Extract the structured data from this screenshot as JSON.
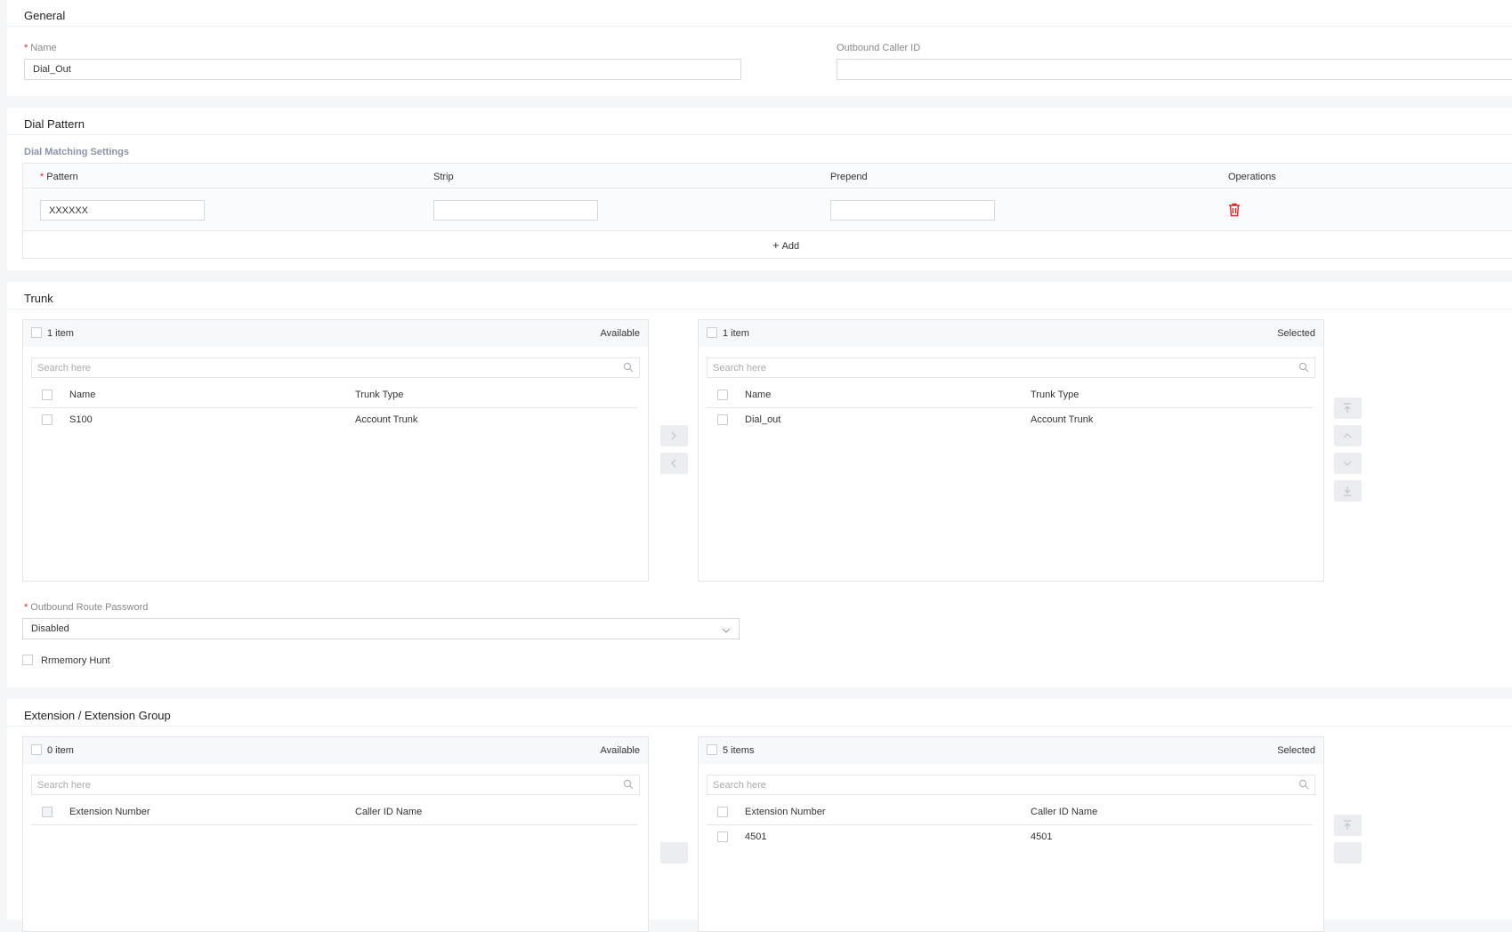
{
  "general": {
    "title": "General",
    "name_label": "Name",
    "name_value": "Dial_Out",
    "caller_id_label": "Outbound Caller ID",
    "caller_id_value": ""
  },
  "dial_pattern": {
    "title": "Dial Pattern",
    "subtitle": "Dial Matching Settings",
    "columns": {
      "pattern": "Pattern",
      "strip": "Strip",
      "prepend": "Prepend",
      "operations": "Operations"
    },
    "row": {
      "pattern": "XXXXXX",
      "strip": "",
      "prepend": ""
    },
    "add_label": "Add"
  },
  "trunk": {
    "title": "Trunk",
    "available": {
      "count": "1 item",
      "status": "Available",
      "search_placeholder": "Search here",
      "col_name": "Name",
      "col_type": "Trunk Type",
      "rows": [
        {
          "name": "S100",
          "type": "Account Trunk"
        }
      ]
    },
    "selected": {
      "count": "1 item",
      "status": "Selected",
      "search_placeholder": "Search here",
      "col_name": "Name",
      "col_type": "Trunk Type",
      "rows": [
        {
          "name": "Dial_out",
          "type": "Account Trunk"
        }
      ]
    },
    "password_label": "Outbound Route Password",
    "password_value": "Disabled",
    "memory_hunt_label": "Rrmemory Hunt"
  },
  "extension": {
    "title": "Extension / Extension Group",
    "available": {
      "count": "0 item",
      "status": "Available",
      "search_placeholder": "Search here",
      "col_number": "Extension Number",
      "col_caller": "Caller ID Name"
    },
    "selected": {
      "count": "5 items",
      "status": "Selected",
      "search_placeholder": "Search here",
      "col_number": "Extension Number",
      "col_caller": "Caller ID Name",
      "rows": [
        {
          "number": "4501",
          "caller": "4501"
        }
      ]
    }
  },
  "colors": {
    "required": "#e02424",
    "delete_icon": "#e02424",
    "subtitle": "#8a94a6"
  },
  "icons": [
    "search-icon",
    "trash-icon",
    "plus-icon",
    "chevron-right-icon",
    "chevron-left-icon",
    "move-top-icon",
    "move-up-icon",
    "move-down-icon",
    "move-bottom-icon",
    "chevron-down-icon"
  ]
}
